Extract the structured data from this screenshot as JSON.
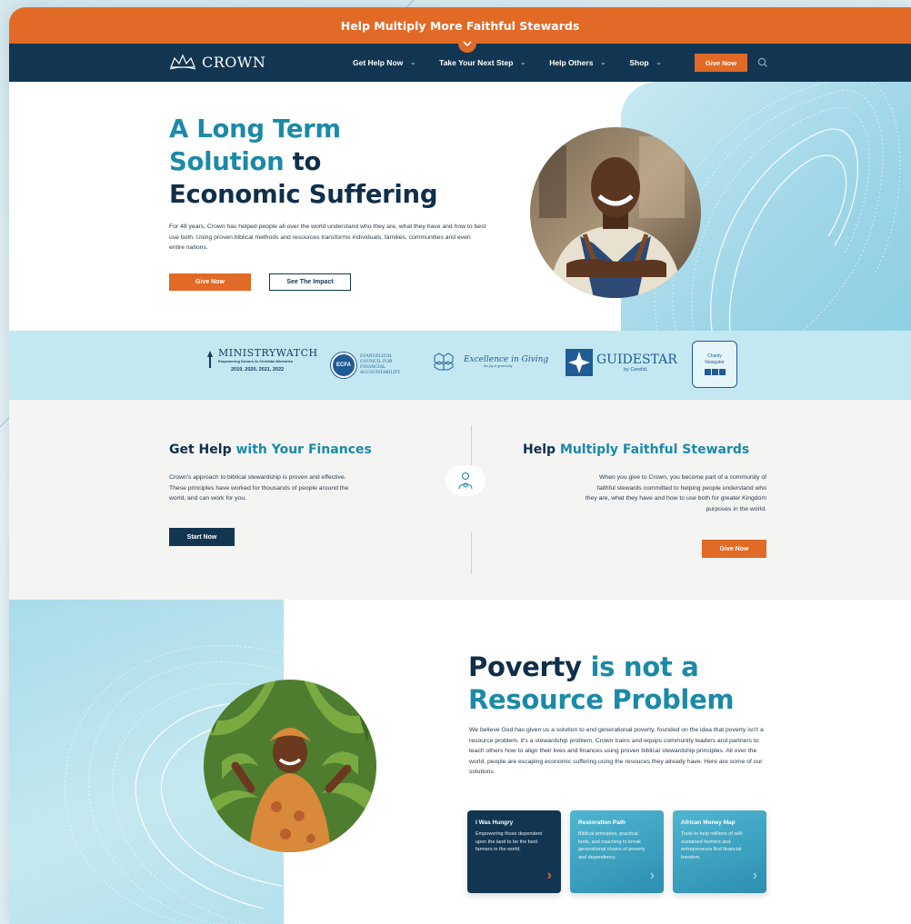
{
  "promo": {
    "text": "Help Multiply More Faithful Stewards"
  },
  "nav": {
    "logo_text": "CROWN",
    "links": [
      {
        "label": "Get Help Now"
      },
      {
        "label": "Take Your Next Step"
      },
      {
        "label": "Help Others"
      },
      {
        "label": "Shop"
      }
    ],
    "give_label": "Give Now"
  },
  "hero": {
    "title_line1_hl": "A Long Term",
    "title_line2_hl": "Solution",
    "title_line2_rest": " to",
    "title_line3": "Economic Suffering",
    "body": "For 48 years, Crown has helped people all over the world understand who they are, what they have and how to best use both. Using proven biblical methods and resources transforms individuals, families, communities and even entire nations.",
    "give_label": "Give Now",
    "impact_label": "See The Impact"
  },
  "logos": {
    "ministrywatch": {
      "name": "MINISTRYWATCH",
      "tagline": "Empowering Donors to Christian Ministries",
      "years": "2019, 2020, 2021, 2022"
    },
    "ecfa": {
      "badge": "ECFA",
      "line1": "EVANGELICAL",
      "line2": "COUNCIL FOR",
      "line3": "FINANCIAL",
      "line4": "ACCOUNTABILITY"
    },
    "excellence": {
      "name": "Excellence in Giving",
      "tagline": "the joy of generosity"
    },
    "guidestar": {
      "name": "GUIDESTAR",
      "sub": "by Candid."
    },
    "charity": {
      "line1": "Charity",
      "line2": "Navigator"
    }
  },
  "help": {
    "left_title_a": "Get Help",
    "left_title_b": " with Your Finances",
    "left_body": "Crown's approach to biblical stewardship is proven and effective. These principles have worked for thousands of people around the world, and can work for you.",
    "start_label": "Start Now",
    "right_title_a": "Help ",
    "right_title_b": "Multiply Faithful Stewards",
    "right_body": "When you give to Crown, you become part of a community of faithful stewards committed to helping people understand who they are, what they have and how to use both for greater Kingdom purposes in the world.",
    "give_label": "Give Now"
  },
  "poverty": {
    "title_a": "Poverty",
    "title_b": " is not a",
    "title_c": "Resource Problem",
    "body": "We believe God has given us a solution to end generational poverty, founded on the idea that poverty isn't a resource problem, it's a stewardship problem. Crown trains and equips community leaders and partners to teach others how to align their lives and finances using proven biblical stewardship principles. All over the world, people are escaping economic suffering using the resouces they already have. Here are some of our solutions.",
    "cards": [
      {
        "title": "I Was Hungry",
        "body": "Empowering those dependent upon the land to be the best farmers in the world.",
        "color": "#123652"
      },
      {
        "title": "Restoration Path",
        "body": "Biblical principles, practical tools, and coaching to break generational chains of poverty and dependency.",
        "color": "#3aa3c0"
      },
      {
        "title": "African Money Map",
        "body": "Tools to help millions of self-sustained farmers and entrepreneurs find financial freedom.",
        "color": "#3aa3c0"
      }
    ]
  },
  "colors": {
    "orange": "#e06a26",
    "navy": "#123652",
    "teal": "#1b8aa8",
    "light_blue": "#c4e8f1"
  }
}
